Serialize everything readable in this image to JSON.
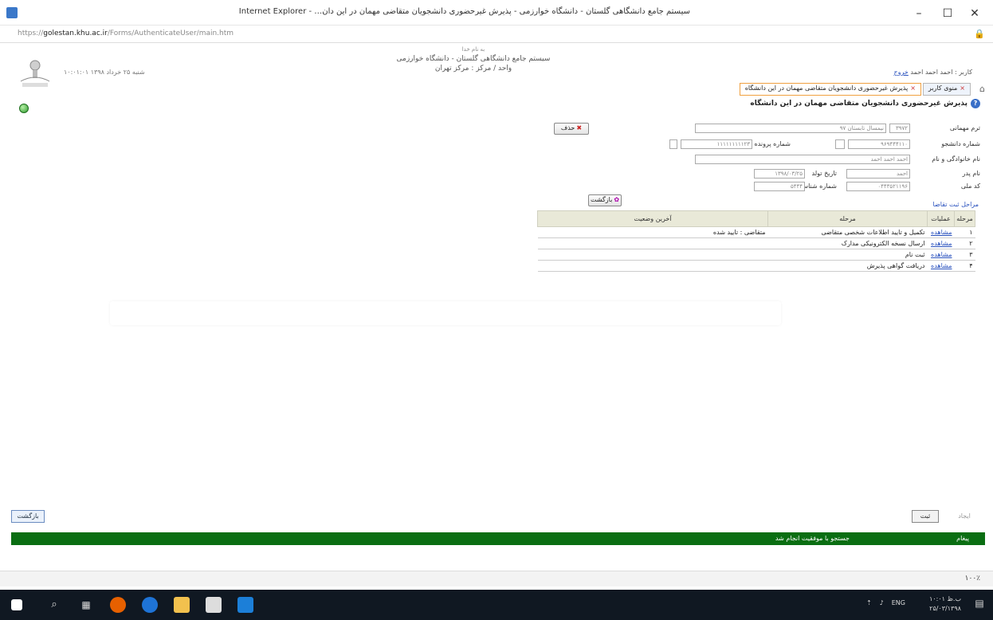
{
  "window": {
    "title": "سیستم جامع دانشگاهی گلستان - دانشگاه خوارزمی - پذیرش غیرحضوری دانشجویان متقاضی مهمان در این دان… - Internet Explorer",
    "url_prefix": "https://",
    "url_host": "golestan.khu.ac.ir",
    "url_path": "/Forms/AuthenticateUser/main.htm"
  },
  "header": {
    "bismillah": "به نام خدا",
    "system_name": "سیستم جامع دانشگاهی گلستان - دانشگاه خوارزمی",
    "unit": "واحد / مرکز : مرکز تهران",
    "date": "شنبه ۲۵ خرداد ۱۳۹۸ ۱۰:۰۱:۰۱",
    "user_text": "کاربر : احمد احمد احمد",
    "logout": "خروج"
  },
  "tabs": [
    {
      "label": "منوی کاربر"
    },
    {
      "label": "پذیرش غیرحضوری دانشجویان متقاضی مهمان در این دانشگاه"
    }
  ],
  "form": {
    "title": "پذیرش غیرحضوری دانشجویان متقاضی مهمان در این دانشگاه",
    "term_label": "ترم مهمانی",
    "term_code": "۳۹۷۲",
    "term_name": "نیمسال تابستان ۹۷",
    "student_no_label": "شماره دانشجو",
    "student_no": "۹۶۹۴۴۴۱۱۰",
    "file_no_label": "شماره پرونده",
    "file_no": "۱۱۱۱۱۱۱۱۱۲۳",
    "name_label": "نام خانوادگی و نام",
    "name_value": "احمد احمد احمد",
    "father_label": "نام پدر",
    "father_value": "احمد",
    "birth_label": "تاریخ تولد",
    "birth_value": "۱۳۹۸/۰۳/۲۵",
    "national_label": "کد ملی",
    "national_value": "۰۴۴۳۵۲۱۱۹۶",
    "id_label": "شماره شناسنامه",
    "id_value": "۵۴۴۴",
    "delete_btn": "حذف",
    "back_btn": "بازگشت",
    "steps_title": "مراحل ثبت تقاضا"
  },
  "grid": {
    "headers": [
      "مرحله",
      "عملیات",
      "مرحله",
      "آخرین وضعیت"
    ],
    "rows": [
      {
        "num": "۱",
        "op": "مشاهده",
        "step": "تکمیل و تایید اطلاعات شخصی متقاضی",
        "status": "متقاضی : تایید شده"
      },
      {
        "num": "۲",
        "op": "مشاهده",
        "step": "ارسال نسخه الکترونیکی مدارک",
        "status": ""
      },
      {
        "num": "۳",
        "op": "مشاهده",
        "step": "ثبت نام",
        "status": ""
      },
      {
        "num": "۴",
        "op": "مشاهده",
        "step": "دریافت گواهی پذیرش",
        "status": ""
      }
    ]
  },
  "footer": {
    "back_left": "بازگشت",
    "btn_mid": "ثبت",
    "btn_right": "ایجاد",
    "status_label": "پیغام",
    "status_msg": "جستجو با موفقیت انجام شد"
  },
  "ie_status": {
    "zoom": "۱۰۰٪"
  },
  "taskbar": {
    "lang": "ENG",
    "time": "۱۰:۰۱ ب.ظ",
    "date": "۲۵/۰۳/۱۳۹۸"
  }
}
